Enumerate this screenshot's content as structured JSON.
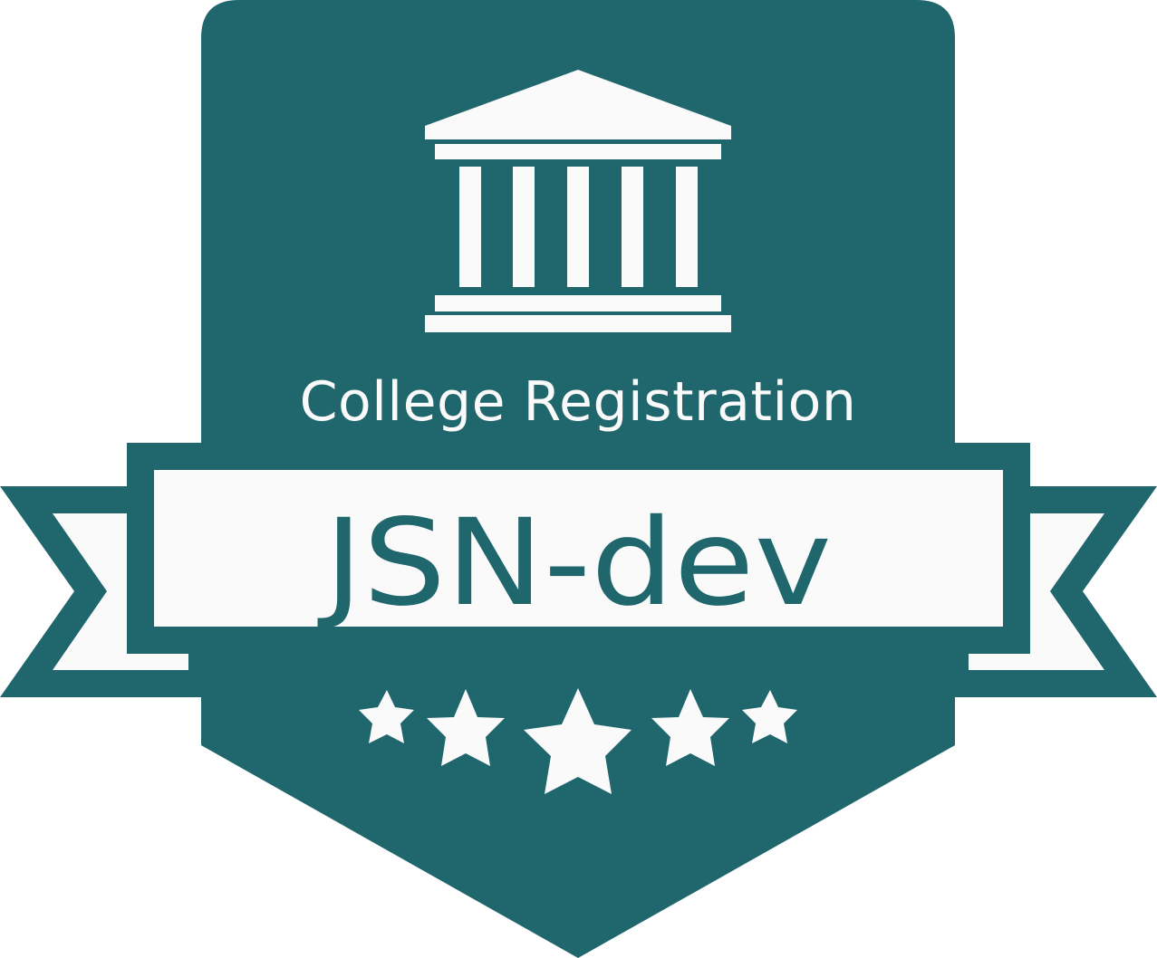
{
  "badge": {
    "subtitle": "College Registration",
    "title": "JSN-dev",
    "icon": "bank-building-icon",
    "rating": {
      "value": 5,
      "max": 5
    },
    "colors": {
      "primary": "#1f666d",
      "light": "#fafafa"
    }
  }
}
